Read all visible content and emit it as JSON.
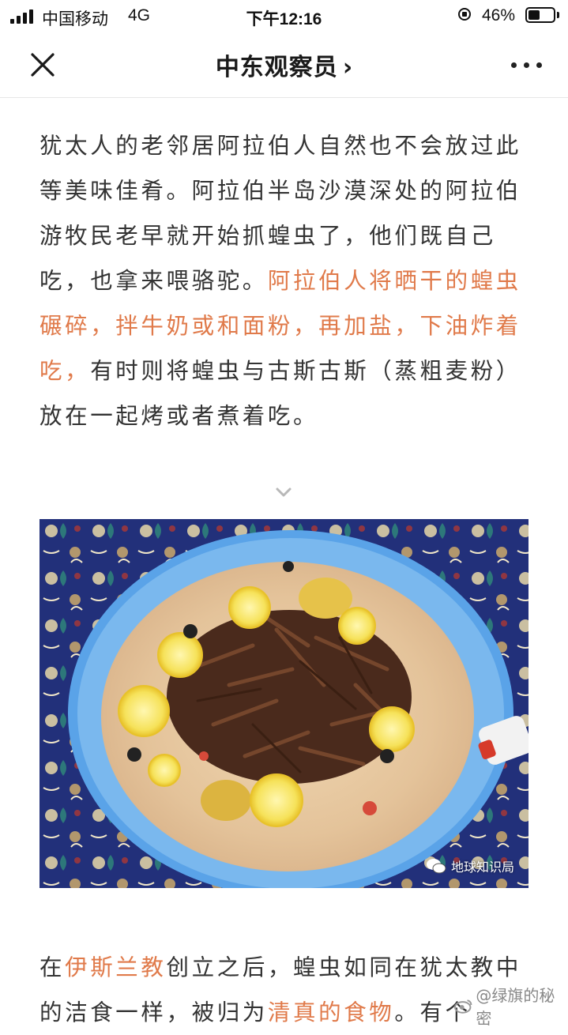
{
  "status_bar": {
    "carrier": "中国移动",
    "network": "4G",
    "time": "下午12:16",
    "battery_percent": "46%",
    "battery_level": 0.46,
    "signal_bars": 4
  },
  "nav": {
    "title": "中东观察员",
    "chevron": "›",
    "close_icon": "close-icon",
    "more_icon": "more-icon"
  },
  "article": {
    "p1": {
      "a": "犹太人的老邻居阿拉伯人自然也不会放过此等美味佳肴。阿拉伯半岛沙漠深处的阿拉伯游牧民老早就开始抓蝗虫了，他们既自己吃，也拿来喂骆驼。",
      "highlight": "阿拉伯人将晒干的蝗虫碾碎，拌牛奶或和面粉，再加盐，下油炸着吃，",
      "b": "有时则将蝗虫与古斯古斯（蒸粗麦粉）放在一起烤或者煮着吃。"
    },
    "image_watermark": "地球知识局",
    "p2": {
      "a": "在",
      "hl1": "伊斯兰教",
      "b": "创立之后，蝗虫如同在犹太教中的洁食一样，被归为",
      "hl2": "清真的食物",
      "c": "。有个"
    },
    "accent_color": "#e07a4a"
  },
  "overlay": {
    "weibo_watermark": "@绿旗的秘密"
  }
}
